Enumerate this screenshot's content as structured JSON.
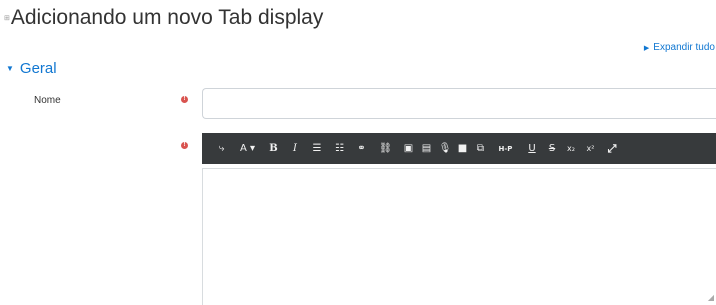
{
  "page": {
    "title": "Adicionando um novo Tab display",
    "title_mark": "⊞"
  },
  "expand_link": {
    "label": "Expandir tudo"
  },
  "section": {
    "title": "Geral"
  },
  "form": {
    "name_label": "Nome",
    "name_value": "",
    "required_icon": "!"
  },
  "toolbar": {
    "buttons": [
      {
        "icon": "collapse-icon",
        "glyph": "⤷"
      },
      {
        "icon": "font-size-icon",
        "glyph": "A ▾"
      },
      {
        "icon": "bold-icon",
        "glyph": "B"
      },
      {
        "icon": "italic-icon",
        "glyph": "I"
      },
      {
        "icon": "unordered-list-icon",
        "glyph": "☰"
      },
      {
        "icon": "ordered-list-icon",
        "glyph": "☷"
      },
      {
        "icon": "link-icon",
        "glyph": "⚭"
      },
      {
        "icon": "unlink-icon",
        "glyph": "⛓"
      },
      {
        "icon": "image-icon",
        "glyph": "▣"
      },
      {
        "icon": "media-icon",
        "glyph": "▤"
      },
      {
        "icon": "record-audio-icon",
        "glyph": "🎙"
      },
      {
        "icon": "record-video-icon",
        "glyph": "■"
      },
      {
        "icon": "manage-files-icon",
        "glyph": "⧉"
      },
      {
        "icon": "h5p-icon",
        "glyph": "H-P"
      },
      {
        "icon": "underline-icon",
        "glyph": "U"
      },
      {
        "icon": "strikethrough-icon",
        "glyph": "S"
      },
      {
        "icon": "subscript-icon",
        "glyph": "x₂"
      },
      {
        "icon": "superscript-icon",
        "glyph": "x²"
      },
      {
        "icon": "fullscreen-icon",
        "glyph": "⤢"
      }
    ]
  },
  "editor": {
    "content": ""
  },
  "colors": {
    "link": "#1177d1",
    "toolbar_bg": "#373a3c",
    "required": "#d9534f"
  }
}
